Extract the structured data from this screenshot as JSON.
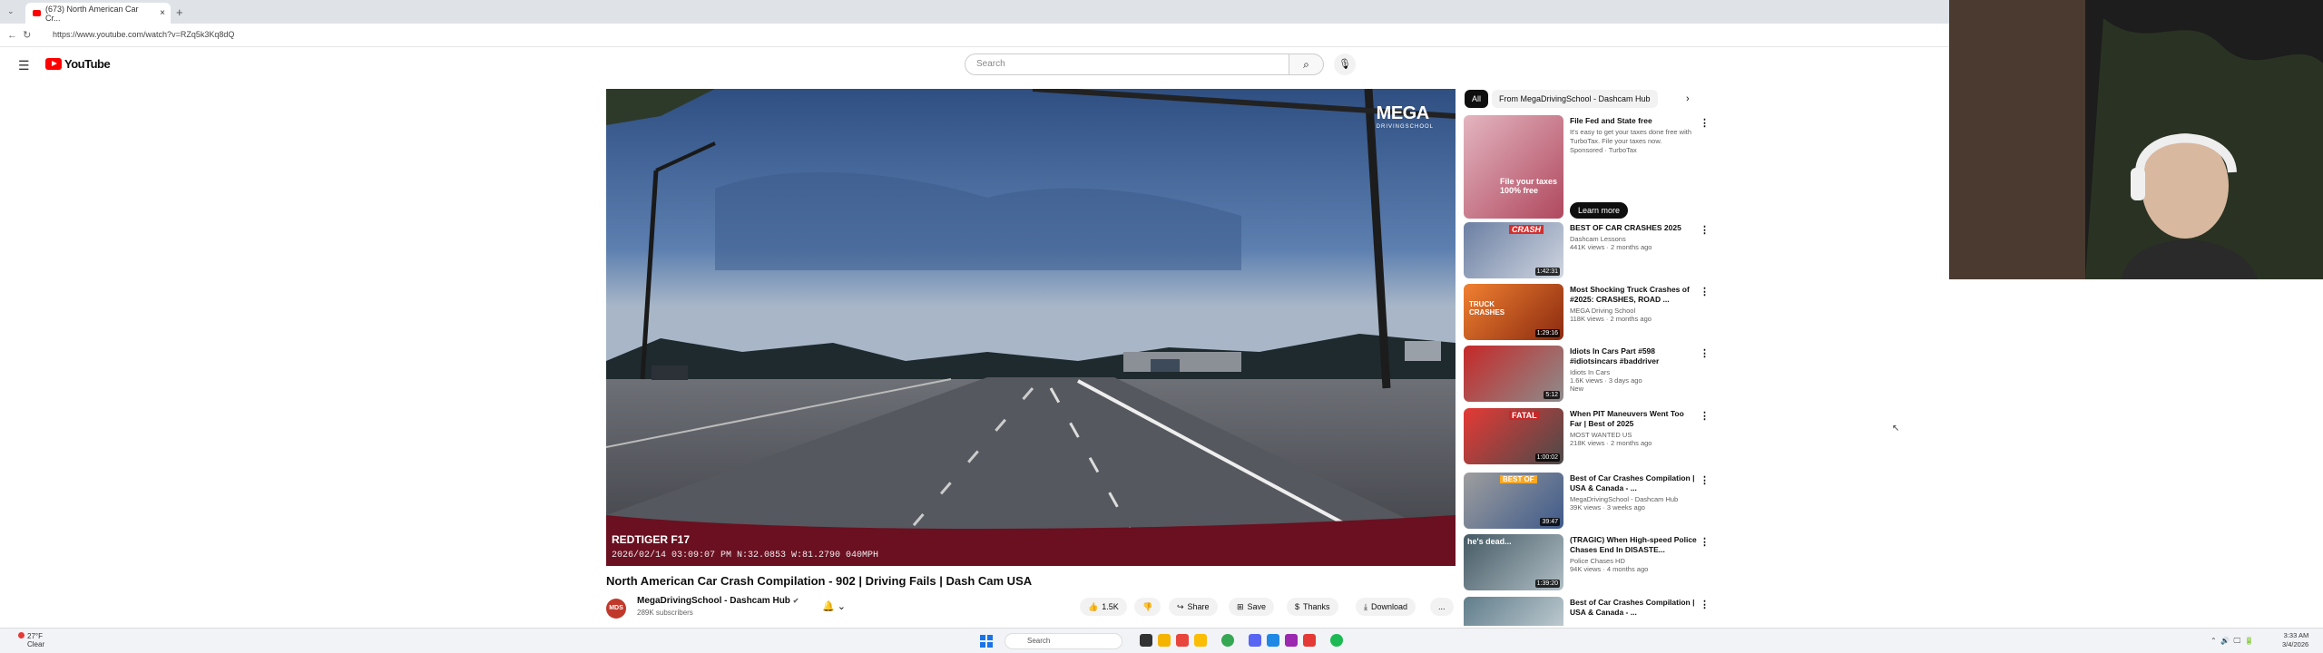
{
  "browser": {
    "tab_title": "(673) North American Car Cr...",
    "tab_close": "×",
    "new_tab": "+",
    "url": "https://www.youtube.com/watch?v=RZq5k3Kq8dQ"
  },
  "youtube": {
    "logo_text": "YouTube",
    "search_placeholder": "Search"
  },
  "player": {
    "watermark": "MEGA",
    "watermark_sub": "DRIVINGSCHOOL",
    "dashcam_brand": "REDTIGER F17",
    "dashcam_stamp": "2026/02/14  03:09:07 PM N:32.0853 W:81.2790 040MPH"
  },
  "video": {
    "title": "North American Car Crash Compilation - 902 | Driving Fails | Dash Cam USA",
    "avatar_text": "MDS",
    "channel": "MegaDrivingSchool - Dashcam Hub",
    "subscribers": "289K subscribers",
    "actions": {
      "like": "1.5K",
      "share": "Share",
      "save": "Save",
      "thanks": "Thanks",
      "download": "Download",
      "more": "..."
    }
  },
  "chips": {
    "all": "All",
    "from": "From MegaDrivingSchool - Dashcam Hub"
  },
  "ad": {
    "title": "File Fed and State free",
    "desc": "It's easy to get your taxes done free with TurboTax. File your taxes now.",
    "sponsor": "Sponsored · TurboTax",
    "thumb_text": "File your taxes 100% free",
    "button": "Learn more"
  },
  "recommendations": [
    {
      "title": "BEST OF CAR CRASHES 2025",
      "channel": "Dashcam Lessons",
      "meta": "441K views · 2 months ago",
      "duration": "1:42:31",
      "thumb_text": "CRASH"
    },
    {
      "title": "Most Shocking Truck Crashes of #2025: CRASHES, ROAD ...",
      "channel": "MEGA Driving School",
      "meta": "118K views · 2 months ago",
      "duration": "1:29:16",
      "thumb_text": "TRUCK CRASHES"
    },
    {
      "title": "Idiots In Cars Part #598 #idiotsincars #baddriver",
      "channel": "Idiots In Cars",
      "meta": "1.6K views · 3 days ago",
      "duration": "5:12",
      "badge": "New",
      "thumb_text": ""
    },
    {
      "title": "When PIT Maneuvers Went Too Far | Best of 2025",
      "channel": "MOST WANTED US",
      "meta": "218K views · 2 months ago",
      "duration": "1:00:02",
      "thumb_text": "FATAL"
    },
    {
      "title": "Best of Car Crashes Compilation | USA & Canada - ...",
      "channel": "MegaDrivingSchool - Dashcam Hub",
      "meta": "39K views · 3 weeks ago",
      "duration": "39:47",
      "thumb_text": "BEST OF"
    },
    {
      "title": "(TRAGIC) When High-speed Police Chases End In DISASTE...",
      "channel": "Police Chases HD",
      "meta": "94K views · 4 months ago",
      "duration": "1:39:20",
      "thumb_text": "he's dead..."
    },
    {
      "title": "Best of Car Crashes Compilation | USA & Canada - ...",
      "channel": "",
      "meta": "",
      "duration": "",
      "thumb_text": ""
    }
  ],
  "taskbar": {
    "weather_temp": "27°F",
    "weather_desc": "Clear",
    "search": "Search",
    "time": "3:33 AM",
    "date": "3/4/2026"
  },
  "colors": {
    "yt_red": "#ff0000",
    "chip_active": "#0f0f0f",
    "chip_bg": "#f2f2f2"
  }
}
